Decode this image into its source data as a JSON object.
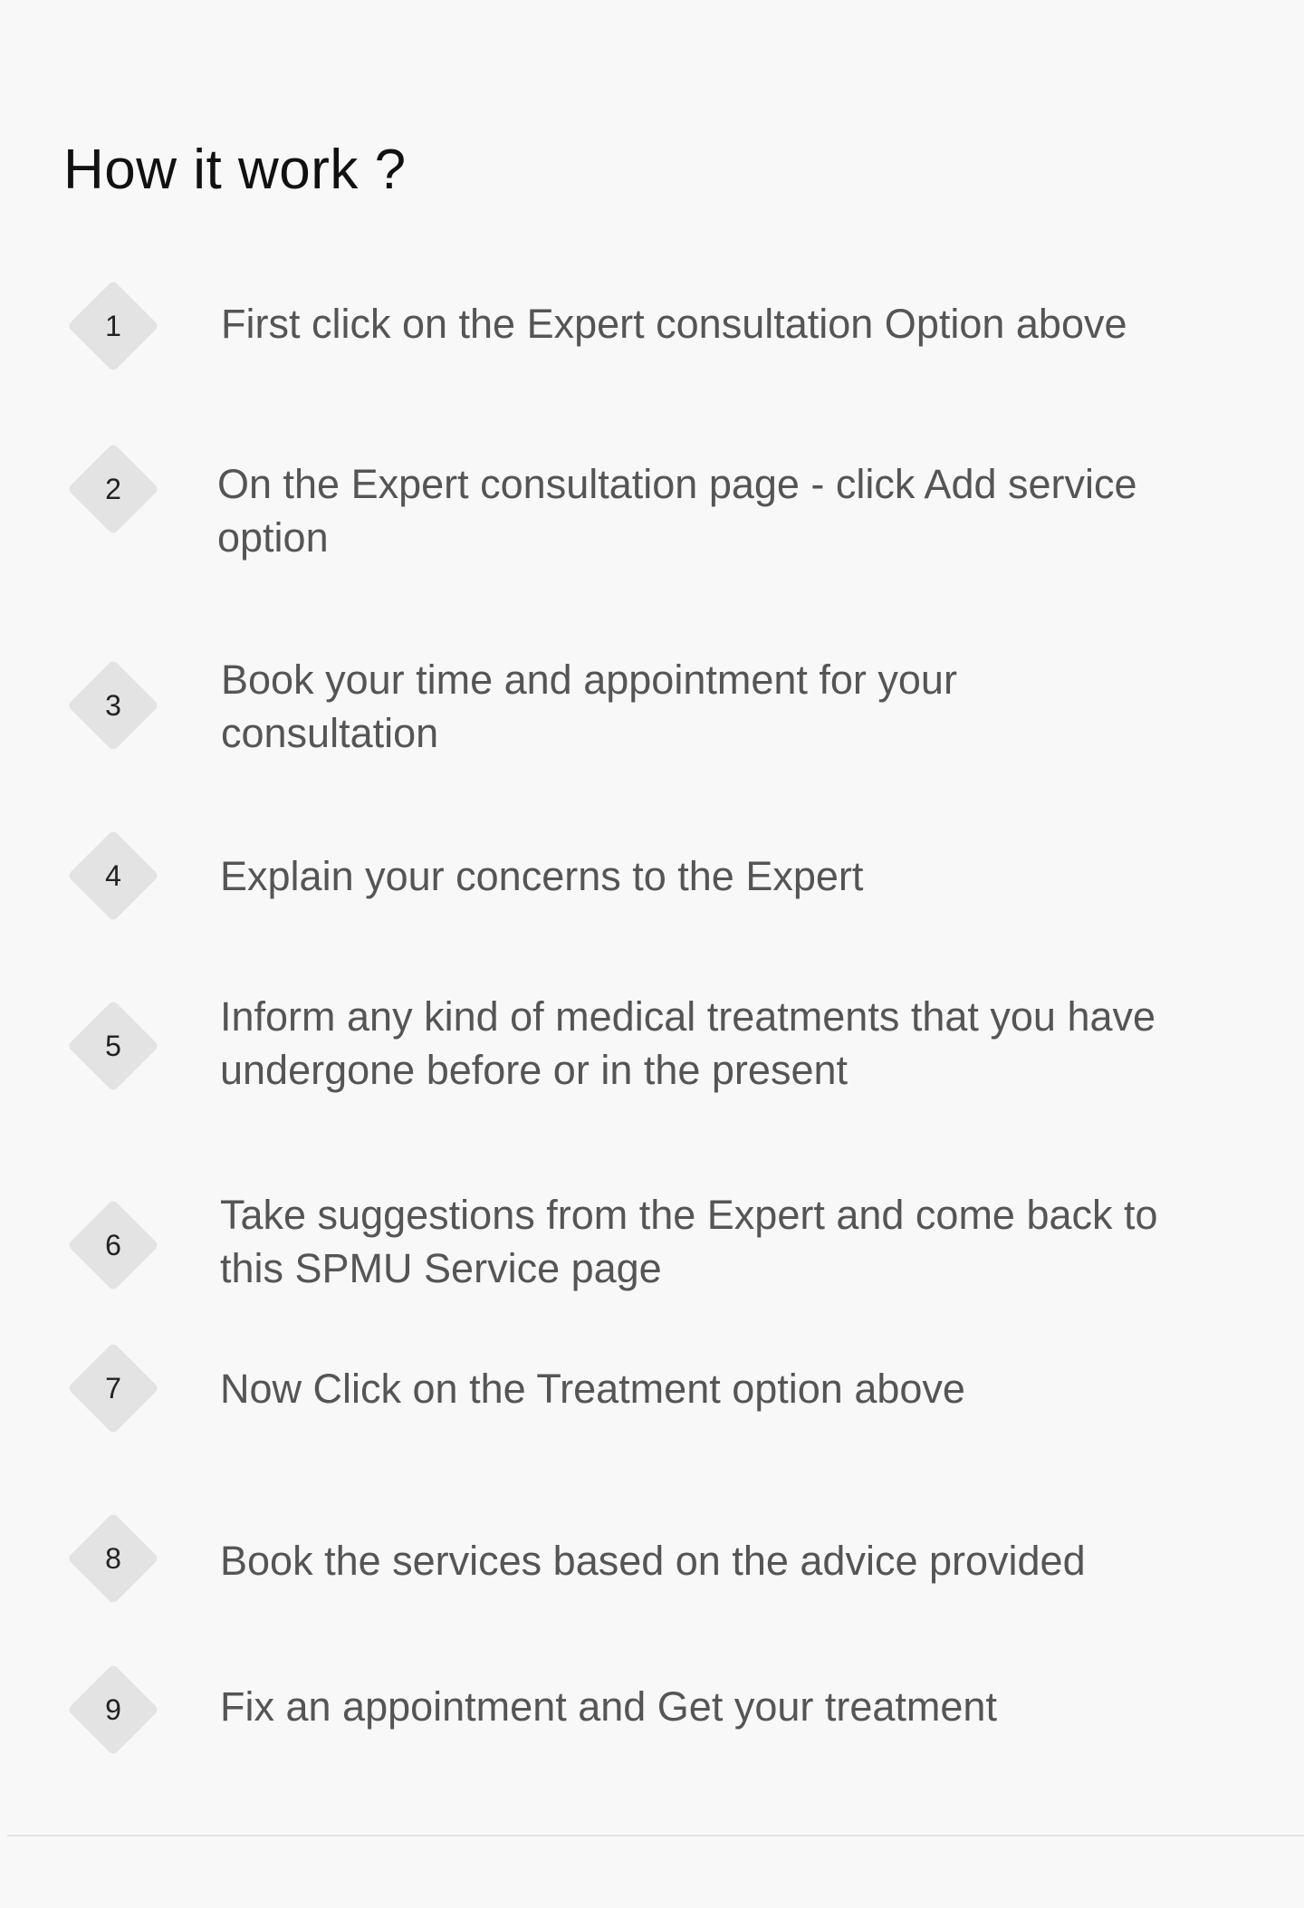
{
  "title": "How it work ?",
  "steps": [
    {
      "number": "1",
      "text": "First click on the Expert consultation Option above"
    },
    {
      "number": "2",
      "text": "On the Expert consultation page - click Add service option"
    },
    {
      "number": "3",
      "text": "Book your time and appointment for your consultation"
    },
    {
      "number": "4",
      "text": "Explain your concerns to the Expert"
    },
    {
      "number": "5",
      "text": "Inform any kind of medical treatments that you have undergone before or in the present"
    },
    {
      "number": "6",
      "text": "Take suggestions from the Expert and come back to this SPMU Service page"
    },
    {
      "number": "7",
      "text": "Now Click on the Treatment option above"
    },
    {
      "number": "8",
      "text": "Book the services based on the advice provided"
    },
    {
      "number": "9",
      "text": "Fix an appointment and Get your treatment"
    }
  ]
}
